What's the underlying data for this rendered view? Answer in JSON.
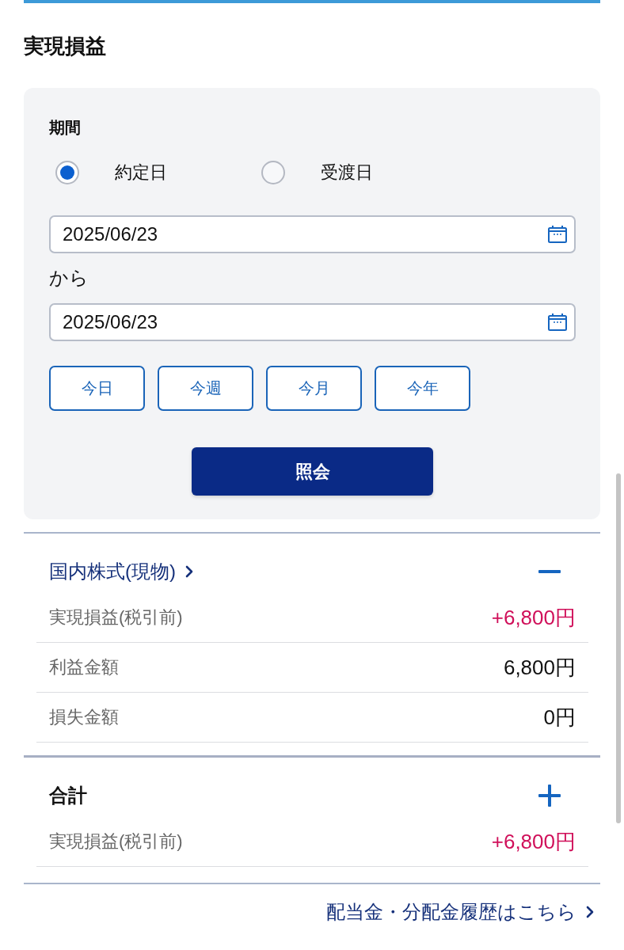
{
  "title": "実現損益",
  "filter": {
    "label": "期間",
    "date_basis": [
      {
        "label": "約定日",
        "selected": true
      },
      {
        "label": "受渡日",
        "selected": false
      }
    ],
    "date_from": {
      "value": "2025/06/23"
    },
    "range_word": "から",
    "date_to": {
      "value": "2025/06/23"
    },
    "quick_ranges": [
      {
        "label": "今日"
      },
      {
        "label": "今週"
      },
      {
        "label": "今月"
      },
      {
        "label": "今年"
      }
    ],
    "submit": "照会"
  },
  "sections": [
    {
      "kind": "link",
      "title": "国内株式(現物)",
      "expanded": true,
      "rows": [
        {
          "kind": "pnl",
          "label": "実現損益(税引前)",
          "value": "+6,800円"
        },
        {
          "kind": "amount",
          "label": "利益金額",
          "value": "6,800円"
        },
        {
          "kind": "amount",
          "label": "損失金額",
          "value": "0円"
        }
      ]
    },
    {
      "kind": "total",
      "title": "合計",
      "expanded": false,
      "rows": [
        {
          "kind": "pnl",
          "label": "実現損益(税引前)",
          "value": "+6,800円"
        }
      ]
    }
  ],
  "footer_link": "配当金・分配金履歴はこちら"
}
